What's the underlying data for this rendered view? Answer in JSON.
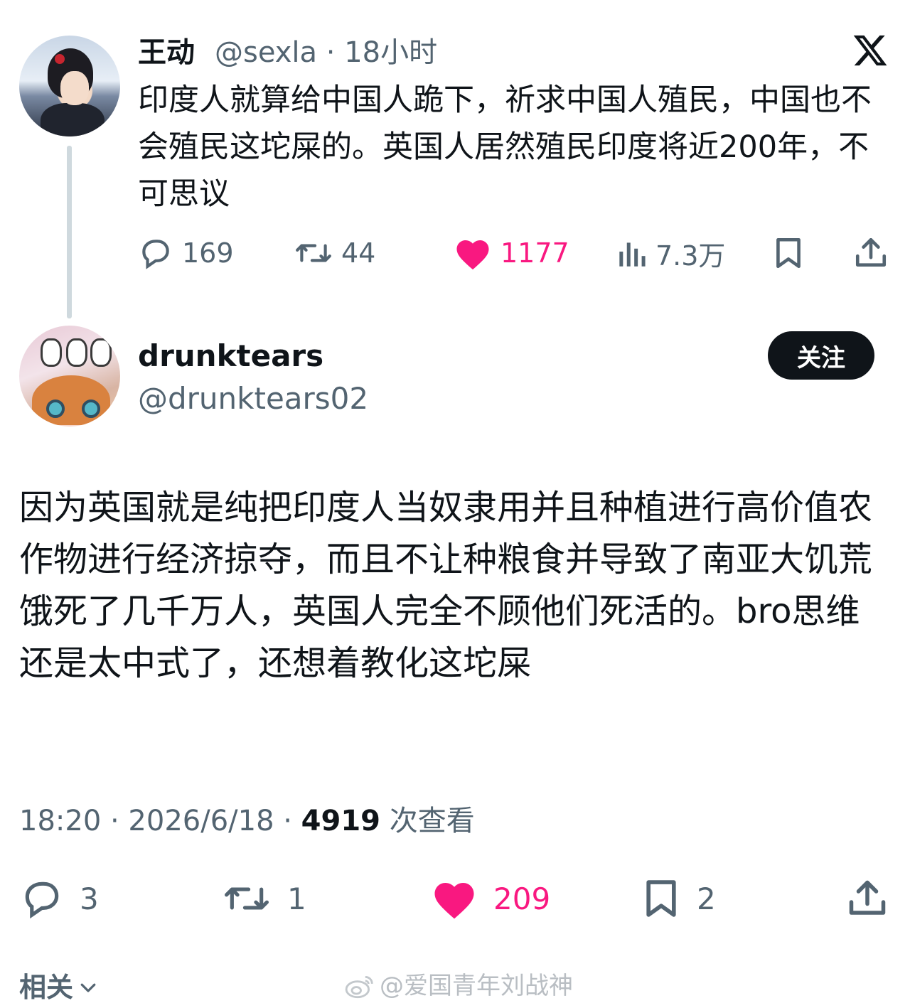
{
  "parent_tweet": {
    "author_name": "王动",
    "author_meta": "@sexla · 18小时",
    "text": "印度人就算给中国人跪下，祈求中国人殖民，中国也不会殖民这坨屎的。英国人居然殖民印度将近200年，不可思议",
    "stats": {
      "replies": "169",
      "retweets": "44",
      "likes": "1177",
      "views": "7.3万"
    }
  },
  "reply_tweet": {
    "author_name": "drunktears",
    "author_handle": "@drunktears02",
    "follow_label": "关注",
    "text": "因为英国就是纯把印度人当奴隶用并且种植进行高价值农作物进行经济掠夺，而且不让种粮食并导致了南亚大饥荒饿死了几千万人，英国人完全不顾他们死活的。bro思维还是太中式了，还想着教化这坨屎",
    "time": "18:20 · 2026/6/18 · ",
    "view_count": "4919",
    "view_suffix": " 次查看",
    "stats": {
      "replies": "3",
      "retweets": "1",
      "likes": "209",
      "bookmarks": "2"
    }
  },
  "related_label": "相关",
  "watermark": "@爱国青年刘战神",
  "colors": {
    "like": "#f91880",
    "secondary": "#536471",
    "primary": "#0f1419",
    "thread_line": "#cfd9de"
  },
  "icons": [
    "x-logo-icon",
    "reply-icon",
    "retweet-icon",
    "heart-icon",
    "views-icon",
    "bookmark-icon",
    "share-icon",
    "chevron-down-icon",
    "weibo-icon"
  ]
}
